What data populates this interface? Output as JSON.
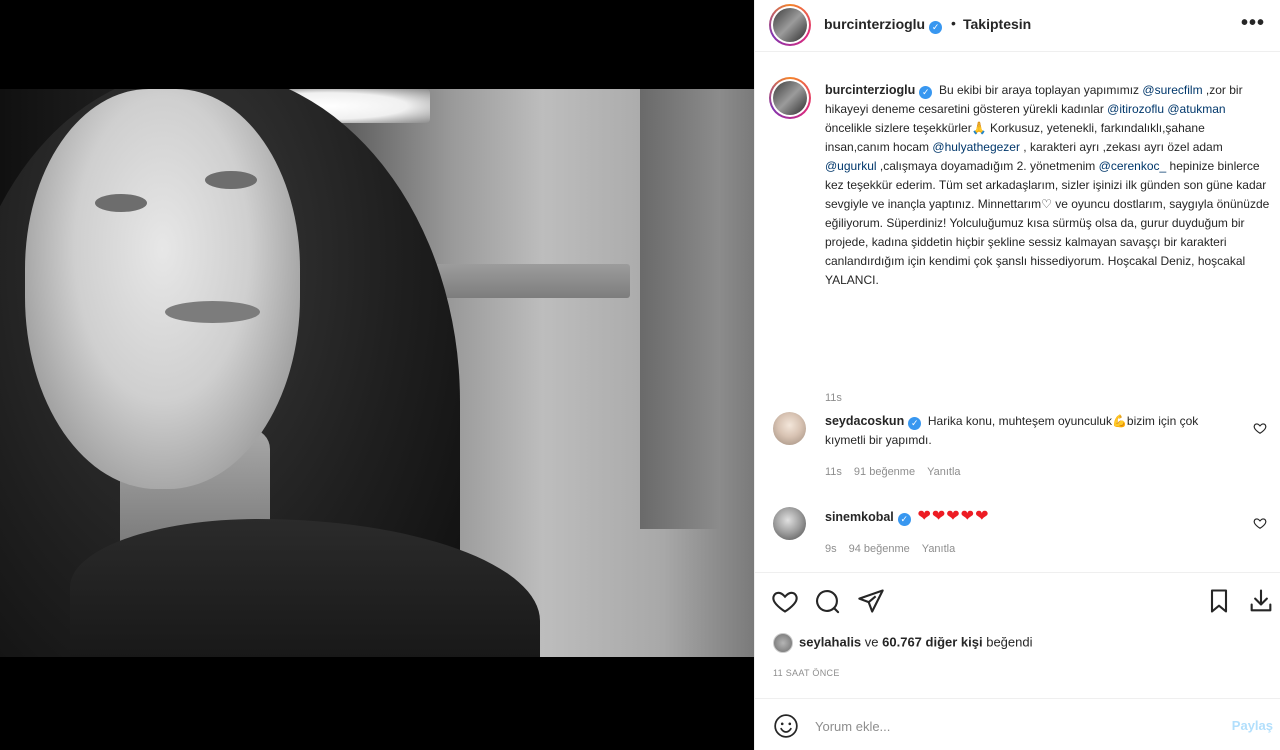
{
  "post": {
    "username": "burcinterzioglu",
    "verified_mark": "✓",
    "follow_separator": "•",
    "follow_status": "Takiptesin",
    "more_icon": "•••"
  },
  "caption": {
    "username": "burcinterzioglu",
    "segments": [
      {
        "t": "Bu ekibi bir araya toplayan yapımımız "
      },
      {
        "m": "@surecfilm"
      },
      {
        "t": " ,zor bir hikayeyi deneme cesaretini gösteren yürekli kadınlar "
      },
      {
        "m": "@itirozoflu"
      },
      {
        "t": " "
      },
      {
        "m": "@atukman"
      },
      {
        "t": " öncelikle sizlere teşekkürler🙏 Korkusuz, yetenekli, farkındalıklı,şahane insan,canım hocam "
      },
      {
        "m": "@hulyathegezer"
      },
      {
        "t": " , karakteri ayrı ,zekası ayrı özel adam "
      },
      {
        "m": "@ugurkul"
      },
      {
        "t": " ,calışmaya doyamadığım 2. yönetmenim "
      },
      {
        "m": "@cerenkoc_"
      },
      {
        "t": " hepinize binlerce kez teşekkür ederim. Tüm set arkadaşlarım, sizler işinizi ilk günden son güne kadar sevgiyle ve inançla yaptınız. Minnettarım♡ ve oyuncu dostlarım, saygıyla önünüzde eğiliyorum. Süperdiniz! Yolculuğumuz kısa sürmüş olsa da, gurur duyduğum bir projede, kadına şiddetin hiçbir şekline sessiz kalmayan savaşçı bir karakteri canlandırdığım için kendimi çok şanslı hissediyorum. Hoşcakal Deniz, hoşcakal YALANCI."
      }
    ],
    "time": "11s"
  },
  "comments": [
    {
      "username": "seydacoskun",
      "text": "Harika konu, muhteşem oyunculuk💪bizim için çok kıymetli bir yapımdı.",
      "time": "11s",
      "likes": "91 beğenme",
      "reply": "Yanıtla"
    },
    {
      "username": "sinemkobal",
      "text": "❤❤❤❤❤",
      "time": "9s",
      "likes": "94 beğenme",
      "reply": "Yanıtla"
    }
  ],
  "likes": {
    "user": "seylahalis",
    "connector": "ve",
    "count": "60.767 diğer kişi",
    "suffix": "beğendi"
  },
  "post_time": "11 SAAT ÖNCE",
  "add_comment": {
    "placeholder": "Yorum ekle...",
    "share_label": "Paylaş"
  },
  "icons": {
    "like": "heart-icon",
    "comment": "comment-icon",
    "share": "paper-plane-icon",
    "save": "bookmark-icon",
    "download": "download-icon",
    "emoji": "smiley-icon"
  }
}
